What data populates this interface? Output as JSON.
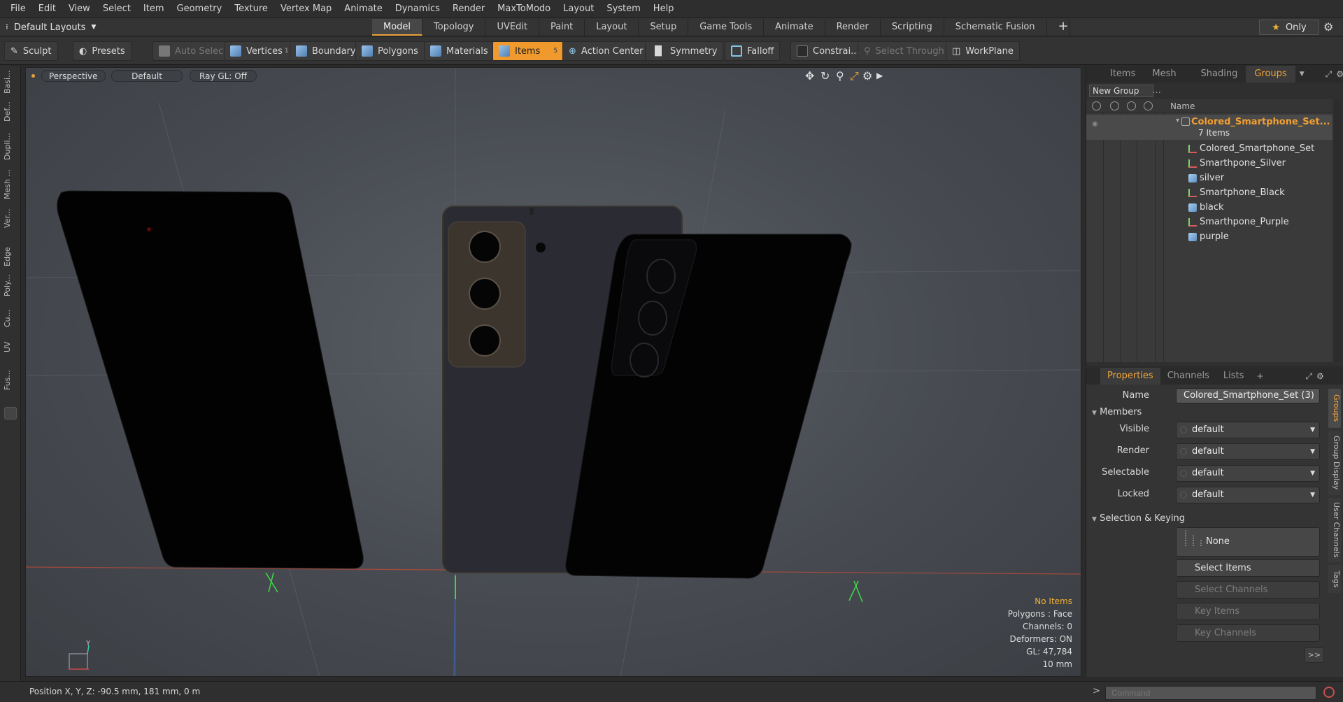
{
  "menu": [
    "File",
    "Edit",
    "View",
    "Select",
    "Item",
    "Geometry",
    "Texture",
    "Vertex Map",
    "Animate",
    "Dynamics",
    "Render",
    "MaxToModo",
    "Layout",
    "System",
    "Help"
  ],
  "layouts": {
    "dropdown": "Default Layouts",
    "tabs": [
      "Model",
      "Topology",
      "UVEdit",
      "Paint",
      "Layout",
      "Setup",
      "Game Tools",
      "Animate",
      "Render",
      "Scripting",
      "Schematic Fusion"
    ],
    "active_tab": "Model",
    "only_label": "Only"
  },
  "toolbar": {
    "sculpt": "Sculpt",
    "presets": "Presets",
    "auto_select": "Auto Select",
    "vertices": "Vertices",
    "vertices_count": "1",
    "boundary": "Boundary",
    "polygons": "Polygons",
    "materials": "Materials",
    "items": "Items",
    "items_count": "5",
    "action_center": "Action Center",
    "symmetry": "Symmetry",
    "falloff": "Falloff",
    "constraints": "Constrai...",
    "select_through": "Select Through",
    "workplane": "WorkPlane"
  },
  "left_tabs": [
    "Basi...",
    "Def...",
    "Dupli...",
    "Mesh ...",
    "Ver...",
    "Edge",
    "Poly...",
    "Cu...",
    "UV",
    "Fus..."
  ],
  "viewport": {
    "view": "Perspective",
    "shading": "Default",
    "raygl": "Ray GL: Off",
    "stats": {
      "items": "No Items",
      "polygons": "Polygons : Face",
      "channels": "Channels: 0",
      "deformers": "Deformers: ON",
      "gl": "GL: 47,784",
      "scale": "10 mm"
    },
    "axis_label": "Y"
  },
  "items_panel": {
    "tabs": [
      "Items",
      "Mesh ...",
      "Shading",
      "Groups"
    ],
    "active_tab": "Groups",
    "new_group": "New Group",
    "col_name": "Name",
    "group_name": "Colored_Smartphone_Set...",
    "group_count": "7 Items",
    "children": [
      {
        "name": "Colored_Smartphone_Set",
        "kind": "locator"
      },
      {
        "name": "Smarthpone_Silver",
        "kind": "locator"
      },
      {
        "name": "silver",
        "kind": "mesh"
      },
      {
        "name": "Smartphone_Black",
        "kind": "locator"
      },
      {
        "name": "black",
        "kind": "mesh"
      },
      {
        "name": "Smarthpone_Purple",
        "kind": "locator"
      },
      {
        "name": "purple",
        "kind": "mesh"
      }
    ]
  },
  "properties": {
    "tabs": [
      "Properties",
      "Channels",
      "Lists"
    ],
    "active_tab": "Properties",
    "name_label": "Name",
    "name_value": "Colored_Smartphone_Set (3)",
    "members_label": "Members",
    "visible_label": "Visible",
    "visible_value": "default",
    "render_label": "Render",
    "render_value": "default",
    "selectable_label": "Selectable",
    "selectable_value": "default",
    "locked_label": "Locked",
    "locked_value": "default",
    "sel_keying_label": "Selection & Keying",
    "none_label": "None",
    "select_items": "Select Items",
    "select_channels": "Select Channels",
    "key_items": "Key Items",
    "key_channels": "Key Channels",
    "more": ">>",
    "side_tabs": [
      "Groups",
      "Group Display",
      "User Channels",
      "Tags"
    ]
  },
  "status": {
    "position": "Position X, Y, Z:  -90.5 mm, 181 mm, 0 m",
    "command_placeholder": "Command"
  },
  "colors": {
    "accent": "#f09a2e",
    "group_title": "#f29f30"
  }
}
